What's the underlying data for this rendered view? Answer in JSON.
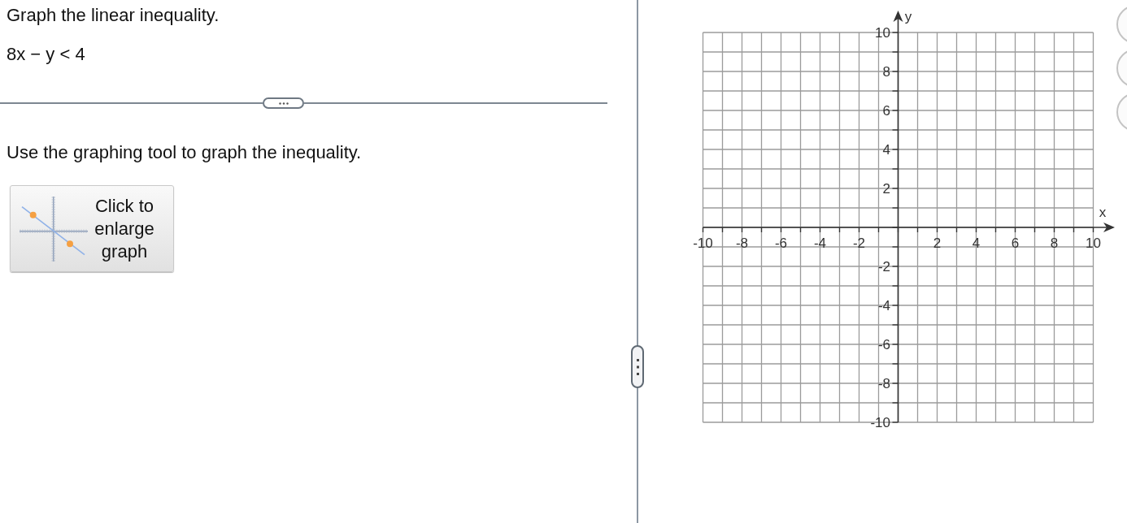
{
  "question": {
    "prompt": "Graph the linear inequality.",
    "inequality": "8x − y < 4"
  },
  "instruction": "Use the graphing tool to graph the inequality.",
  "enlarge_button": {
    "label": "Click to enlarge graph"
  },
  "graph": {
    "chart_data": {
      "type": "scatter",
      "grid": true,
      "xlabel": "x",
      "ylabel": "y",
      "xlim": [
        -10,
        10
      ],
      "ylim": [
        -10,
        10
      ],
      "xticks": [
        -10,
        -8,
        -6,
        -4,
        -2,
        2,
        4,
        6,
        8,
        10
      ],
      "yticks": [
        10,
        8,
        6,
        4,
        2,
        -2,
        -4,
        -6,
        -8,
        -10
      ]
    }
  }
}
